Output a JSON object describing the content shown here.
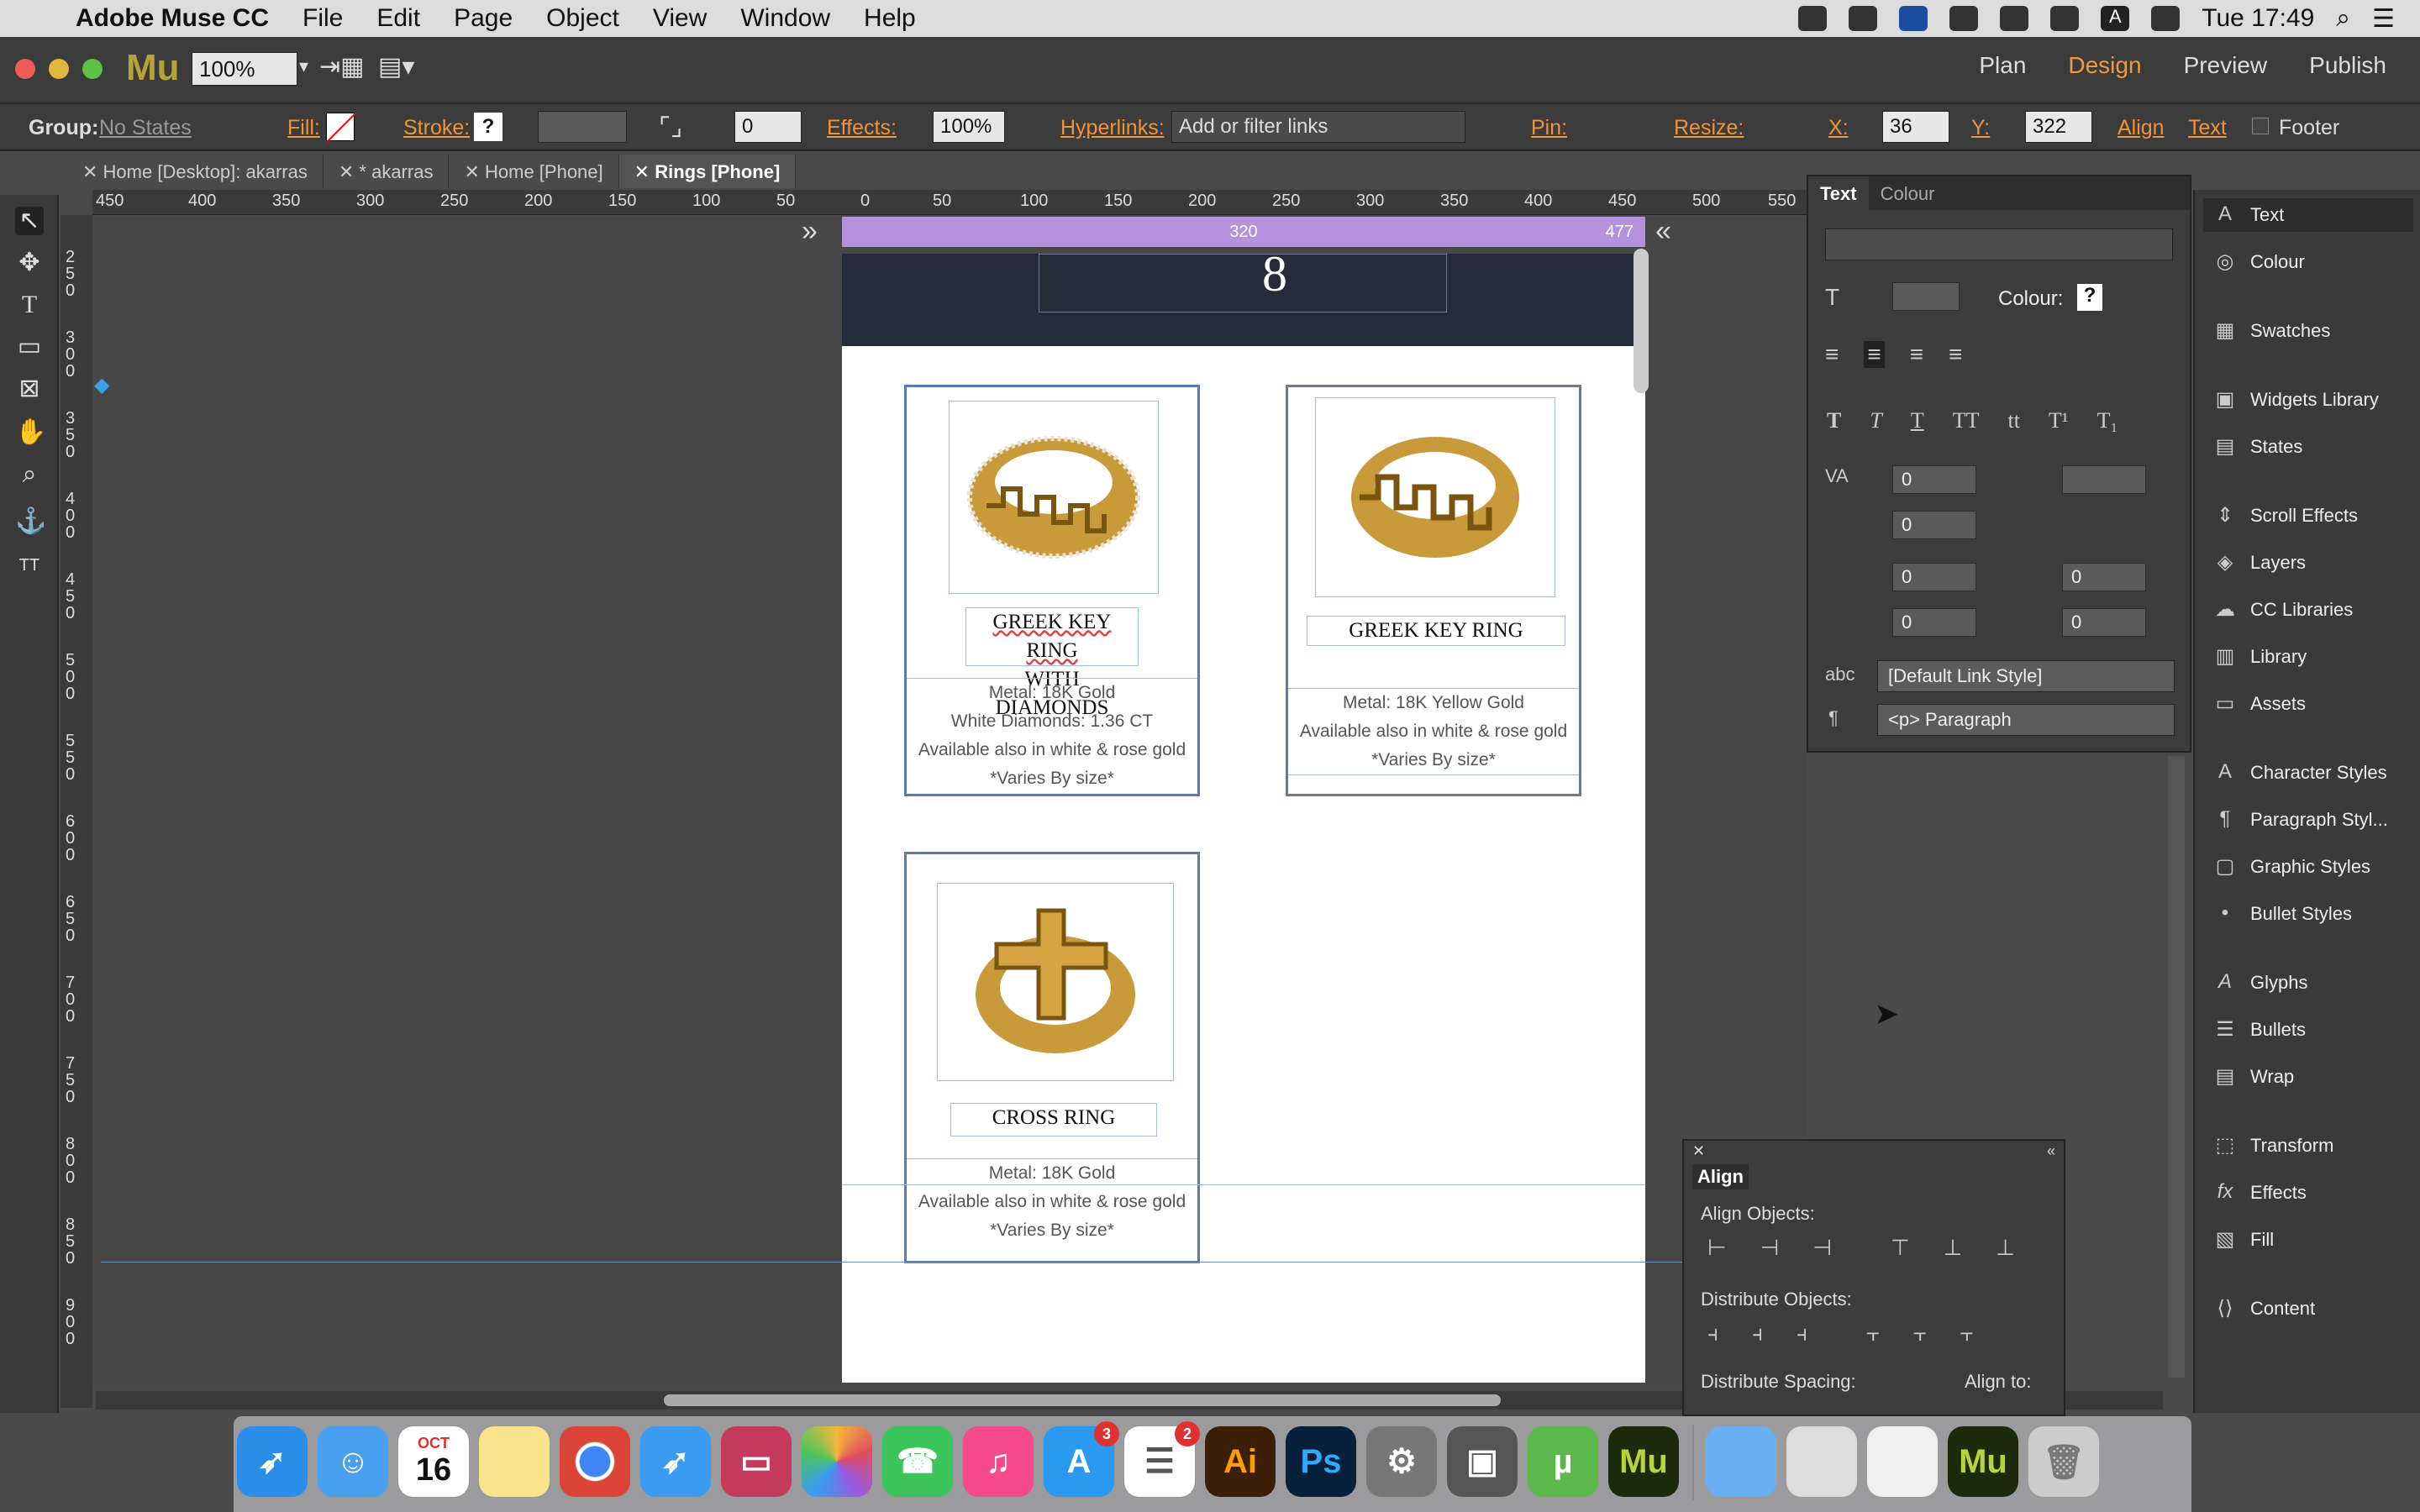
{
  "menubar": {
    "app": "Adobe Muse CC",
    "items": [
      "File",
      "Edit",
      "Page",
      "Object",
      "View",
      "Window",
      "Help"
    ],
    "clock": "Tue 17:49"
  },
  "titlebar": {
    "logo": "Mu",
    "zoom": "100%",
    "modes": [
      "Plan",
      "Design",
      "Preview",
      "Publish"
    ],
    "active_mode": "Design"
  },
  "options": {
    "group_label": "Group:",
    "states": "No States",
    "fill": "Fill:",
    "stroke": "Stroke:",
    "stroke_val": "?",
    "corner": "0",
    "effects": "Effects:",
    "opacity": "100%",
    "hyperlinks": "Hyperlinks:",
    "links_placeholder": "Add or filter links",
    "pin": "Pin:",
    "resize": "Resize:",
    "x_label": "X:",
    "x": "36",
    "y_label": "Y:",
    "y": "322",
    "align": "Align",
    "text": "Text",
    "footer": "Footer"
  },
  "tabs": [
    "Home [Desktop]: akarras",
    "* akarras",
    "Home [Phone]",
    "Rings [Phone]"
  ],
  "ruler": {
    "h": [
      "450",
      "400",
      "350",
      "300",
      "250",
      "200",
      "150",
      "100",
      "50",
      "0",
      "50",
      "100",
      "150",
      "200",
      "250",
      "300",
      "350",
      "400",
      "450",
      "500",
      "550"
    ],
    "v": [
      "250",
      "300",
      "350",
      "400",
      "450",
      "500",
      "550",
      "600",
      "650",
      "700",
      "750",
      "800",
      "850",
      "900"
    ]
  },
  "breakpoint": {
    "width": "320",
    "right": "477"
  },
  "cards": [
    {
      "title1": "GREEK KEY RING",
      "title2": "WITH DIAMONDS",
      "lines": [
        "Metal: 18K Gold",
        "White Diamonds: 1.36 CT",
        "Available also in white & rose gold",
        "*Varies By size*"
      ]
    },
    {
      "title1": "GREEK KEY RING",
      "lines": [
        "Metal: 18K Yellow Gold",
        "Available also in white & rose gold",
        "*Varies By size*"
      ]
    },
    {
      "title1": "CROSS RING",
      "lines": [
        "Metal: 18K Gold",
        "Available also in white & rose gold",
        "*Varies By size*"
      ]
    }
  ],
  "text_panel": {
    "tab_text": "Text",
    "tab_colour": "Colour",
    "colour_label": "Colour:",
    "colour_val": "?",
    "tracking": "0",
    "leading": "",
    "indent1": "0",
    "indent2": "0",
    "indent3": "0",
    "indent4": "0",
    "space1": "0",
    "space2": "0",
    "link_style": "[Default Link Style]",
    "paragraph": "<p> Paragraph"
  },
  "side": [
    "Text",
    "Colour",
    "Swatches",
    "Widgets Library",
    "States",
    "Scroll Effects",
    "Layers",
    "CC Libraries",
    "Library",
    "Assets",
    "Character Styles",
    "Paragraph Styl...",
    "Graphic Styles",
    "Bullet Styles",
    "Glyphs",
    "Bullets",
    "Wrap",
    "Transform",
    "Effects",
    "Fill",
    "Content"
  ],
  "align": {
    "title": "Align",
    "objects": "Align Objects:",
    "distribute": "Distribute Objects:",
    "spacing": "Distribute Spacing:",
    "align_to": "Align to:"
  },
  "dock": {
    "calendar_month": "OCT",
    "calendar_day": "16",
    "badge_appstore": "3",
    "badge_reminders": "2"
  }
}
